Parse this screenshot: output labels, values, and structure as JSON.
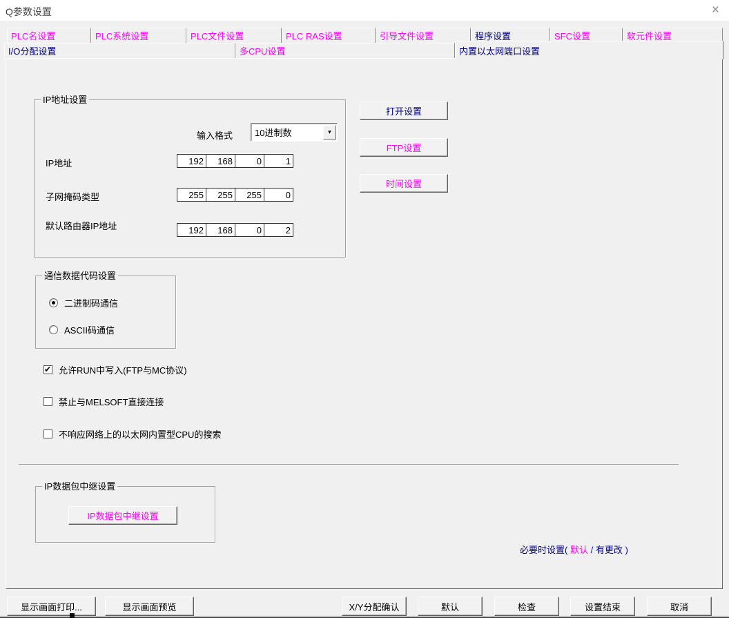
{
  "colors": {
    "magenta": "#ff00ff",
    "navy": "#000080",
    "blue": "#0000ff",
    "dialog_bg": "#f0f0f0"
  },
  "icons": {
    "close": "×",
    "dropdown_arrow": "▼",
    "check": "✔"
  },
  "window": {
    "title": "Q参数设置"
  },
  "tabs": {
    "row1": [
      {
        "label": "PLC名设置",
        "state": "default"
      },
      {
        "label": "PLC系统设置",
        "state": "default"
      },
      {
        "label": "PLC文件设置",
        "state": "default"
      },
      {
        "label": "PLC RAS设置",
        "state": "default"
      },
      {
        "label": "引导文件设置",
        "state": "default"
      },
      {
        "label": "程序设置",
        "state": "changed"
      },
      {
        "label": "SFC设置",
        "state": "default"
      },
      {
        "label": "软元件设置",
        "state": "default"
      }
    ],
    "row2": [
      {
        "label": "I/O分配设置",
        "state": "changed"
      },
      {
        "label": "多CPU设置",
        "state": "default"
      },
      {
        "label": "内置以太网端口设置",
        "state": "changed",
        "active": true
      }
    ]
  },
  "ip_group": {
    "title": "IP地址设置",
    "input_format_label": "输入格式",
    "input_format_value": "10进制数",
    "rows": [
      {
        "label": "IP地址",
        "octets": [
          "192",
          "168",
          "0",
          "1"
        ]
      },
      {
        "label": "子网掩码类型",
        "octets": [
          "255",
          "255",
          "255",
          "0"
        ]
      },
      {
        "label": "默认路由器IP地址",
        "octets": [
          "192",
          "168",
          "0",
          "2"
        ]
      }
    ]
  },
  "side_buttons": [
    {
      "label": "打开设置",
      "state": "changed"
    },
    {
      "label": "FTP设置",
      "state": "default"
    },
    {
      "label": "时间设置",
      "state": "default"
    }
  ],
  "comm_group": {
    "title": "通信数据代码设置",
    "options": [
      {
        "label": "二进制码通信",
        "selected": true
      },
      {
        "label": "ASCII码通信",
        "selected": false
      }
    ]
  },
  "checkboxes": [
    {
      "label": "允许RUN中写入(FTP与MC协议)",
      "checked": true
    },
    {
      "label": "禁止与MELSOFT直接连接",
      "checked": false
    },
    {
      "label": "不响应网络上的以太网内置型CPU的搜索",
      "checked": false
    }
  ],
  "relay_group": {
    "title": "IP数据包中继设置",
    "button_label": "IP数据包中继设置"
  },
  "legend_note": {
    "prefix": "必要时设置(",
    "default_label": " 默认 ",
    "separator": "/",
    "changed_label": " 有更改 ",
    "suffix": ")"
  },
  "bottom_buttons": {
    "print": "显示画面打印...",
    "preview": "显示画面预览",
    "xy_check": "X/Y分配确认",
    "default": "默认",
    "check": "检查",
    "finish": "设置结束",
    "cancel": "取消"
  }
}
